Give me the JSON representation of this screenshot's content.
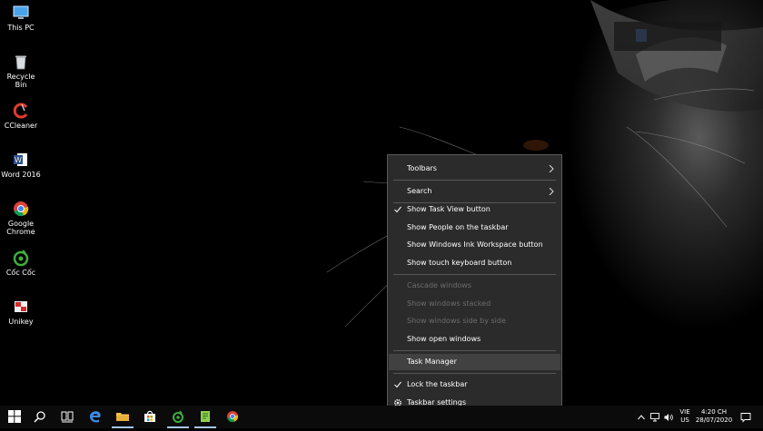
{
  "desktop": {
    "icons": [
      {
        "label": "This PC",
        "icon": "this-pc-icon"
      },
      {
        "label": "Recycle Bin",
        "icon": "recycle-bin-icon"
      },
      {
        "label": "CCleaner",
        "icon": "ccleaner-icon"
      },
      {
        "label": "Word 2016",
        "icon": "word-icon"
      },
      {
        "label": "Google Chrome",
        "icon": "chrome-icon"
      },
      {
        "label": "Cốc Cốc",
        "icon": "coccoc-icon"
      },
      {
        "label": "Unikey",
        "icon": "unikey-icon"
      }
    ]
  },
  "context_menu": {
    "items": [
      {
        "label": "Toolbars",
        "submenu": true
      },
      {
        "label": "Search",
        "submenu": true
      },
      {
        "label": "Show Task View button",
        "checked": true
      },
      {
        "label": "Show People on the taskbar"
      },
      {
        "label": "Show Windows Ink Workspace button"
      },
      {
        "label": "Show touch keyboard button"
      },
      {
        "label": "Cascade windows",
        "disabled": true
      },
      {
        "label": "Show windows stacked",
        "disabled": true
      },
      {
        "label": "Show windows side by side",
        "disabled": true
      },
      {
        "label": "Show open windows"
      },
      {
        "label": "Task Manager",
        "hover": true
      },
      {
        "label": "Lock the taskbar",
        "checked": true
      },
      {
        "label": "Taskbar settings",
        "icon": "gear-icon"
      }
    ]
  },
  "taskbar": {
    "apps": [
      "start-icon",
      "search-icon",
      "task-view-icon",
      "edge-icon",
      "file-explorer-icon",
      "store-icon",
      "coccoc-icon",
      "notepad-icon",
      "chrome-icon"
    ],
    "tray": {
      "lang_top": "VIE",
      "lang_bottom": "US",
      "time": "4:20 CH",
      "date": "28/07/2020"
    }
  },
  "colors": {
    "menu_bg": "#2b2b2b",
    "menu_hover": "#414141",
    "disabled_text": "#6d6d6d",
    "taskbar_bg": "#0b0b0b"
  }
}
